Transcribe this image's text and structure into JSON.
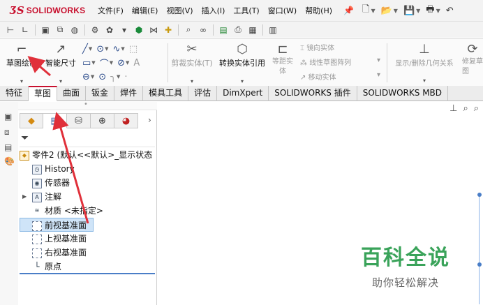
{
  "app": {
    "logo_mark": "ƷS",
    "logo_text": "SOLIDWORKS"
  },
  "menu": {
    "items": [
      "文件(F)",
      "编辑(E)",
      "视图(V)",
      "插入(I)",
      "工具(T)",
      "窗口(W)",
      "帮助(H)"
    ]
  },
  "command_manager": {
    "sketch_label": "草图绘制",
    "smart_dim_label": "智能尺寸",
    "trim_label": "剪裁实体(T)",
    "convert_label": "转换实体引用",
    "offset_label": "等距实体",
    "mirror_label": "镜向实体",
    "linear_pattern_label": "线性草图阵列",
    "move_label": "移动实体",
    "display_relations_label": "显示/删除几何关系",
    "repair_label": "修复草图"
  },
  "tabs": [
    "特征",
    "草图",
    "曲面",
    "钣金",
    "焊件",
    "模具工具",
    "评估",
    "DimXpert",
    "SOLIDWORKS 插件",
    "SOLIDWORKS MBD"
  ],
  "active_tab": "草图",
  "feature_manager": {
    "tree": [
      {
        "label": "零件2  (默认<<默认>_显示状态"
      },
      {
        "label": "History"
      },
      {
        "label": "传感器"
      },
      {
        "label": "注解"
      },
      {
        "label": "材质 <未指定>"
      },
      {
        "label": "前视基准面"
      },
      {
        "label": "上视基准面"
      },
      {
        "label": "右视基准面"
      },
      {
        "label": "原点"
      }
    ]
  },
  "watermark": {
    "title": "百科全说",
    "subtitle": "助你轻松解决"
  },
  "colors": {
    "brand": "#c8102e",
    "arrow": "#e0303a",
    "watermark_green": "#3aa35a",
    "selection": "#cfe4f8"
  }
}
